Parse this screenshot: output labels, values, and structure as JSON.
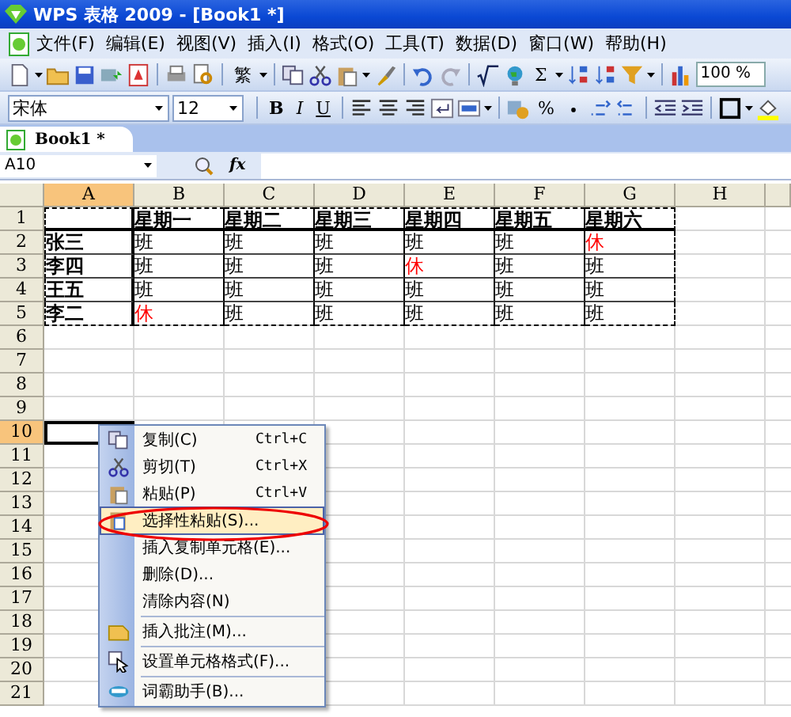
{
  "window": {
    "title": "WPS 表格 2009 - [Book1 *]"
  },
  "menu": [
    "文件(F)",
    "编辑(E)",
    "视图(V)",
    "插入(I)",
    "格式(O)",
    "工具(T)",
    "数据(D)",
    "窗口(W)",
    "帮助(H)"
  ],
  "toolbar": {
    "traditional": "繁",
    "sum": "Σ",
    "zoom": "100 %"
  },
  "format_bar": {
    "font": "宋体",
    "size": "12",
    "bold": "B",
    "italic": "I",
    "underline": "U",
    "percent": "%"
  },
  "tabs": [
    {
      "label": "Book1 *",
      "selected": true
    }
  ],
  "formula_bar": {
    "name_box": "A10",
    "fx": "fx"
  },
  "columns": [
    {
      "label": "A",
      "selected": true
    },
    {
      "label": "B",
      "selected": false
    },
    {
      "label": "C",
      "selected": false
    },
    {
      "label": "D",
      "selected": false
    },
    {
      "label": "E",
      "selected": false
    },
    {
      "label": "F",
      "selected": false
    },
    {
      "label": "G",
      "selected": false
    },
    {
      "label": "H",
      "selected": false
    }
  ],
  "row_headers": [
    {
      "label": "1",
      "selected": false
    },
    {
      "label": "2",
      "selected": false
    },
    {
      "label": "3",
      "selected": false
    },
    {
      "label": "4",
      "selected": false
    },
    {
      "label": "5",
      "selected": false
    },
    {
      "label": "6",
      "selected": false
    },
    {
      "label": "7",
      "selected": false
    },
    {
      "label": "8",
      "selected": false
    },
    {
      "label": "9",
      "selected": false
    },
    {
      "label": "10",
      "selected": true
    },
    {
      "label": "11",
      "selected": false
    },
    {
      "label": "12",
      "selected": false
    },
    {
      "label": "13",
      "selected": false
    },
    {
      "label": "14",
      "selected": false
    },
    {
      "label": "15",
      "selected": false
    },
    {
      "label": "16",
      "selected": false
    },
    {
      "label": "17",
      "selected": false
    },
    {
      "label": "18",
      "selected": false
    },
    {
      "label": "19",
      "selected": false
    },
    {
      "label": "20",
      "selected": false
    },
    {
      "label": "21",
      "selected": false
    }
  ],
  "table": {
    "header": [
      "星期一",
      "星期二",
      "星期三",
      "星期四",
      "星期五",
      "星期六"
    ],
    "rows": [
      {
        "name": "张三",
        "days": [
          {
            "text": "班",
            "color": "#000000"
          },
          {
            "text": "班",
            "color": "#000000"
          },
          {
            "text": "班",
            "color": "#000000"
          },
          {
            "text": "班",
            "color": "#000000"
          },
          {
            "text": "班",
            "color": "#000000"
          },
          {
            "text": "休",
            "color": "#ff0000"
          }
        ]
      },
      {
        "name": "李四",
        "days": [
          {
            "text": "班",
            "color": "#000000"
          },
          {
            "text": "班",
            "color": "#000000"
          },
          {
            "text": "班",
            "color": "#000000"
          },
          {
            "text": "休",
            "color": "#ff0000"
          },
          {
            "text": "班",
            "color": "#000000"
          },
          {
            "text": "班",
            "color": "#000000"
          }
        ]
      },
      {
        "name": "王五",
        "days": [
          {
            "text": "班",
            "color": "#000000"
          },
          {
            "text": "班",
            "color": "#000000"
          },
          {
            "text": "班",
            "color": "#000000"
          },
          {
            "text": "班",
            "color": "#000000"
          },
          {
            "text": "班",
            "color": "#000000"
          },
          {
            "text": "班",
            "color": "#000000"
          }
        ]
      },
      {
        "name": "李二",
        "days": [
          {
            "text": "休",
            "color": "#ff0000"
          },
          {
            "text": "班",
            "color": "#000000"
          },
          {
            "text": "班",
            "color": "#000000"
          },
          {
            "text": "班",
            "color": "#000000"
          },
          {
            "text": "班",
            "color": "#000000"
          },
          {
            "text": "班",
            "color": "#000000"
          }
        ]
      }
    ]
  },
  "context_menu": [
    {
      "kind": "copy",
      "label": "复制(C)",
      "shortcut": "Ctrl+C",
      "selected": false,
      "separator_before": false
    },
    {
      "kind": "cut",
      "label": "剪切(T)",
      "shortcut": "Ctrl+X",
      "selected": false,
      "separator_before": false
    },
    {
      "kind": "paste",
      "label": "粘贴(P)",
      "shortcut": "Ctrl+V",
      "selected": false,
      "separator_before": false
    },
    {
      "kind": "paste-special",
      "label": "选择性粘贴(S)...",
      "selected": true,
      "separator_before": false
    },
    {
      "kind": "plain",
      "label": "插入复制单元格(E)...",
      "selected": false,
      "separator_before": false
    },
    {
      "kind": "plain",
      "label": "删除(D)...",
      "selected": false,
      "separator_before": false
    },
    {
      "kind": "plain",
      "label": "清除内容(N)",
      "selected": false,
      "separator_before": false
    },
    {
      "kind": "comment",
      "label": "插入批注(M)...",
      "selected": false,
      "separator_before": true
    },
    {
      "kind": "format",
      "label": "设置单元格格式(F)...",
      "selected": false,
      "separator_before": true
    },
    {
      "kind": "dict",
      "label": "词霸助手(B)...",
      "selected": false,
      "separator_before": true
    }
  ]
}
